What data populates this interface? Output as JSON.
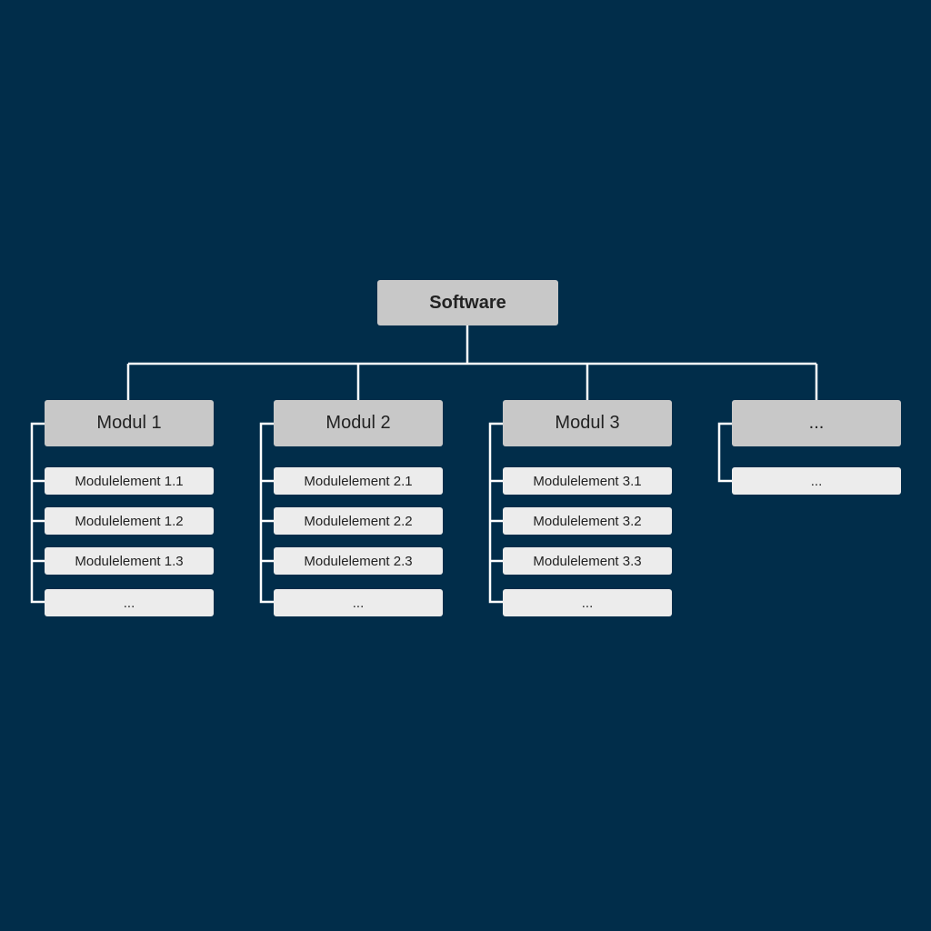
{
  "root": {
    "label": "Software"
  },
  "modules": [
    {
      "label": "Modul 1",
      "items": [
        "Modulelement 1.1",
        "Modulelement 1.2",
        "Modulelement 1.3",
        "..."
      ]
    },
    {
      "label": "Modul 2",
      "items": [
        "Modulelement 2.1",
        "Modulelement 2.2",
        "Modulelement 2.3",
        "..."
      ]
    },
    {
      "label": "Modul 3",
      "items": [
        "Modulelement 3.1",
        "Modulelement 3.2",
        "Modulelement 3.3",
        "..."
      ]
    },
    {
      "label": "...",
      "items": [
        "..."
      ]
    }
  ],
  "colors": {
    "background": "#012d4a",
    "module_box": "#c8c8c8",
    "item_box": "#ececec",
    "connector": "#ffffff"
  }
}
